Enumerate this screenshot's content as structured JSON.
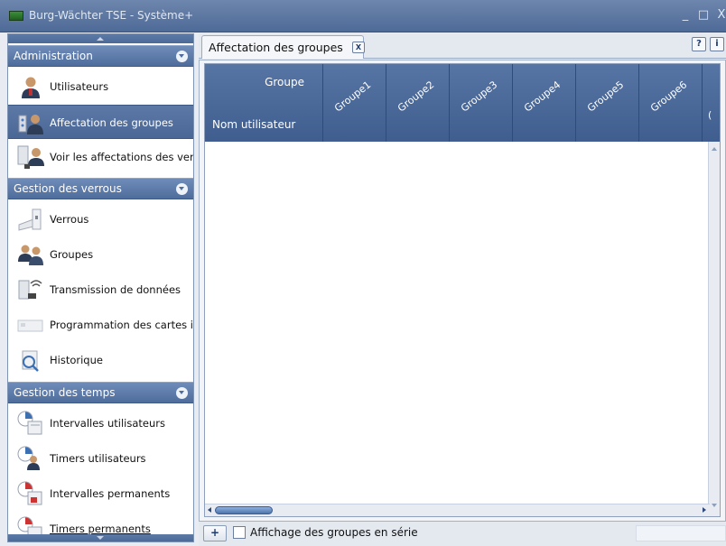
{
  "window": {
    "title": "Burg-Wächter TSE - Système+",
    "minimize": "_",
    "maximize": "□",
    "close": "X"
  },
  "nav": {
    "sections": [
      {
        "label": "Administration",
        "items": [
          {
            "label": "Utilisateurs",
            "icon": "user-icon",
            "selected": false
          },
          {
            "label": "Affectation des groupes",
            "icon": "group-assignment-icon",
            "selected": true
          },
          {
            "label": "Voir les affectations des verrous",
            "icon": "lock-assignment-icon",
            "selected": false
          }
        ]
      },
      {
        "label": "Gestion des verrous",
        "items": [
          {
            "label": "Verrous",
            "icon": "lock-icon",
            "selected": false
          },
          {
            "label": "Groupes",
            "icon": "groups-icon",
            "selected": false
          },
          {
            "label": "Transmission de données",
            "icon": "data-transmission-icon",
            "selected": false
          },
          {
            "label": "Programmation des cartes intelligentes",
            "icon": "smart-card-icon",
            "selected": false
          },
          {
            "label": "Historique",
            "icon": "history-icon",
            "selected": false
          }
        ]
      },
      {
        "label": "Gestion des temps",
        "items": [
          {
            "label": "Intervalles utilisateurs",
            "icon": "user-interval-icon",
            "selected": false
          },
          {
            "label": "Timers utilisateurs",
            "icon": "user-timer-icon",
            "selected": false
          },
          {
            "label": "Intervalles permanents",
            "icon": "permanent-interval-icon",
            "selected": false
          },
          {
            "label": "Timers permanents",
            "icon": "permanent-timer-icon",
            "selected": false
          }
        ]
      }
    ]
  },
  "main": {
    "tab": {
      "label": "Affectation des groupes",
      "close": "X"
    },
    "help": "?",
    "info": "i",
    "grid": {
      "corner_group_label": "Groupe",
      "corner_user_label": "Nom utilisateur",
      "columns": [
        "Groupe1",
        "Groupe2",
        "Groupe3",
        "Groupe4",
        "Groupe5",
        "Groupe6",
        "("
      ]
    },
    "bottom": {
      "add_label": "+",
      "serial_label": "Affichage des groupes en série",
      "serial_checked": false
    }
  },
  "colors": {
    "titlebar": "#5a76a3",
    "section_header": "#5a78a8",
    "selected_item": "#52709f",
    "grid_header": "#4a699a"
  }
}
